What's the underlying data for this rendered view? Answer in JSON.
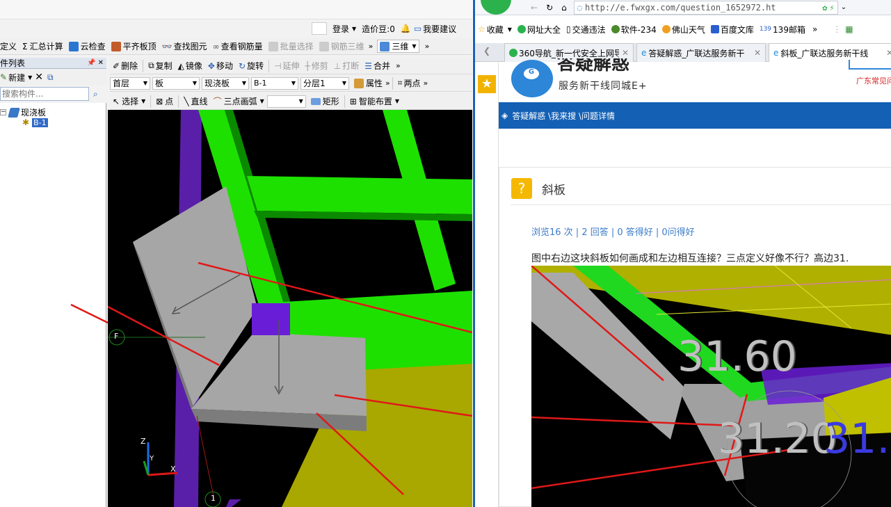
{
  "app": {
    "top_menu": {
      "login": "登录",
      "cost_beans": "造价豆:0",
      "suggest": "我要建议"
    },
    "toolbar1": {
      "define": "定义",
      "sum": "汇总计算",
      "cloud_check": "云检查",
      "flat_slab": "平齐板顶",
      "find_elem": "查找图元",
      "view_rebar": "查看钢筋量",
      "batch_select": "批量选择",
      "rebar_3d": "钢筋三维",
      "view_mode": "三维"
    },
    "panel": {
      "title": "件列表",
      "new_button": "新建",
      "search_placeholder": "搜索构件...",
      "tree_root": "现浇板",
      "tree_child": "B-1"
    },
    "toolbar2": {
      "delete": "删除",
      "copy": "复制",
      "mirror": "镜像",
      "move": "移动",
      "rotate": "旋转",
      "extend": "延伸",
      "trim": "修剪",
      "break": "打断",
      "merge": "合并"
    },
    "toolbar3": {
      "floor": "首层",
      "element_type": "板",
      "slab_type": "现浇板",
      "element_name": "B-1",
      "layer": "分层1",
      "properties": "属性",
      "two_points": "两点"
    },
    "toolbar4": {
      "select": "选择",
      "point": "点",
      "line": "直线",
      "arc": "三点画弧",
      "rect": "矩形",
      "smart_layout": "智能布置"
    },
    "viewport": {
      "axis_f": "F",
      "axis_1": "1",
      "axis_z": "Z",
      "axis_y": "Y",
      "axis_x": "X"
    }
  },
  "browser": {
    "url": "http://e.fwxgx.com/question_1652972.ht",
    "bookmarks": [
      "收藏",
      "网址大全",
      "交通违法",
      "软件-234",
      "佛山天气",
      "百度文库",
      "139邮箱"
    ],
    "tabs": [
      "360导航_新一代安全上网导",
      "答疑解惑_广联达服务新干",
      "斜板_广联达服务新干线"
    ],
    "site_title": "答疑解惑",
    "site_subtitle": "服务新干线同城E+",
    "site_right": "广东常见问",
    "breadcrumb": "答疑解惑 \\我来搜 \\问题详情",
    "question_title": "斜板",
    "stats": "浏览16 次 | 2 回答 | 0 答得好 | 0问得好",
    "question_text": "图中右边这块斜板如何画成和左边相互连接？三点定义好像不行？高边31.",
    "img_label1": "31.60",
    "img_label2": "31.20",
    "img_label2b": "31."
  }
}
